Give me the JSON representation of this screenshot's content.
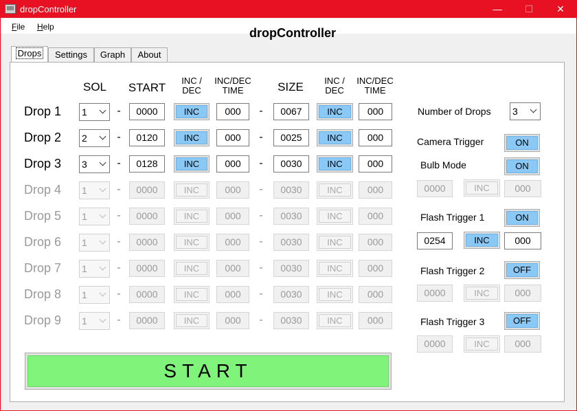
{
  "window": {
    "title": "dropController",
    "min_glyph": "—",
    "max_glyph": "☐",
    "close_glyph": "✕"
  },
  "menu": [
    {
      "accel": "F",
      "rest": "ile"
    },
    {
      "accel": "H",
      "rest": "elp"
    }
  ],
  "app_title": "dropController",
  "tabs": [
    "Drops",
    "Settings",
    "Graph",
    "About"
  ],
  "headers": {
    "sol": "SOL",
    "start": "START",
    "inc_dec": [
      "INC /",
      "DEC"
    ],
    "inc_dec_time": [
      "INC/DEC",
      "TIME"
    ],
    "size": "SIZE",
    "inc_dec2": [
      "INC /",
      "DEC"
    ],
    "inc_dec_time2": [
      "INC/DEC",
      "TIME"
    ]
  },
  "dash": "-",
  "drops": [
    {
      "label": "Drop 1",
      "sol": "1",
      "start": "0000",
      "inc1": "INC",
      "time1": "000",
      "size": "0067",
      "inc2": "INC",
      "time2": "000"
    },
    {
      "label": "Drop 2",
      "sol": "2",
      "start": "0120",
      "inc1": "INC",
      "time1": "000",
      "size": "0025",
      "inc2": "INC",
      "time2": "000"
    },
    {
      "label": "Drop 3",
      "sol": "3",
      "start": "0128",
      "inc1": "INC",
      "time1": "000",
      "size": "0030",
      "inc2": "INC",
      "time2": "000"
    },
    {
      "label": "Drop 4",
      "sol": "1",
      "start": "0000",
      "inc1": "INC",
      "time1": "000",
      "size": "0030",
      "inc2": "INC",
      "time2": "000"
    },
    {
      "label": "Drop 5",
      "sol": "1",
      "start": "0000",
      "inc1": "INC",
      "time1": "000",
      "size": "0030",
      "inc2": "INC",
      "time2": "000"
    },
    {
      "label": "Drop 6",
      "sol": "1",
      "start": "0000",
      "inc1": "INC",
      "time1": "000",
      "size": "0030",
      "inc2": "INC",
      "time2": "000"
    },
    {
      "label": "Drop 7",
      "sol": "1",
      "start": "0000",
      "inc1": "INC",
      "time1": "000",
      "size": "0030",
      "inc2": "INC",
      "time2": "000"
    },
    {
      "label": "Drop 8",
      "sol": "1",
      "start": "0000",
      "inc1": "INC",
      "time1": "000",
      "size": "0030",
      "inc2": "INC",
      "time2": "000"
    },
    {
      "label": "Drop 9",
      "sol": "1",
      "start": "0000",
      "inc1": "INC",
      "time1": "000",
      "size": "0030",
      "inc2": "INC",
      "time2": "000"
    }
  ],
  "side": {
    "num_drops_label": "Number of Drops",
    "num_drops_value": "3",
    "camera_trigger_label": "Camera Trigger",
    "camera_trigger_state": "ON",
    "bulb_mode_label": "Bulb Mode",
    "bulb_mode_state": "ON",
    "bulb_start": "0000",
    "bulb_inc": "INC",
    "bulb_time": "000",
    "flash1_label": "Flash Trigger 1",
    "flash1_state": "ON",
    "flash1_start": "0254",
    "flash1_inc": "INC",
    "flash1_time": "000",
    "flash2_label": "Flash Trigger 2",
    "flash2_state": "OFF",
    "flash2_start": "0000",
    "flash2_inc": "INC",
    "flash2_time": "000",
    "flash3_label": "Flash Trigger 3",
    "flash3_state": "OFF",
    "flash3_start": "0000",
    "flash3_inc": "INC",
    "flash3_time": "000"
  },
  "start_button": "START",
  "colors": {
    "title_bar": "#e81123",
    "active_button": "#8ac8f5",
    "start_button": "#80f47a"
  }
}
